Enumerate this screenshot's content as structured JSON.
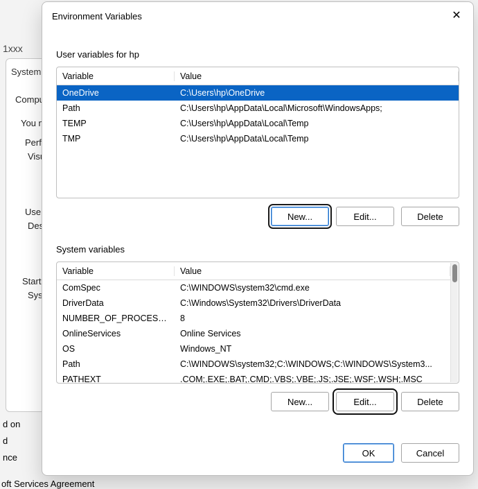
{
  "bg": {
    "top_label": "1xxx",
    "tab_text": "System P",
    "computer": "Compute",
    "you_m": "You m",
    "perfo": "Perfo",
    "visu": "Visu",
    "user": "User",
    "des": "Des",
    "startu": "Startu",
    "syst": "Syst",
    "frag_don": "d on",
    "frag_d": "d",
    "frag_nce": "nce",
    "link_frag": "oft Services Agreement"
  },
  "dialog": {
    "title": "Environment Variables",
    "close_glyph": "✕",
    "user_section_label": "User variables for hp",
    "system_section_label": "System variables",
    "col_variable": "Variable",
    "col_value": "Value",
    "btn_new": "New...",
    "btn_edit": "Edit...",
    "btn_delete": "Delete",
    "btn_ok": "OK",
    "btn_cancel": "Cancel"
  },
  "user_vars": [
    {
      "name": "OneDrive",
      "value": "C:\\Users\\hp\\OneDrive",
      "selected": true
    },
    {
      "name": "Path",
      "value": "C:\\Users\\hp\\AppData\\Local\\Microsoft\\WindowsApps;",
      "selected": false
    },
    {
      "name": "TEMP",
      "value": "C:\\Users\\hp\\AppData\\Local\\Temp",
      "selected": false
    },
    {
      "name": "TMP",
      "value": "C:\\Users\\hp\\AppData\\Local\\Temp",
      "selected": false
    }
  ],
  "system_vars": [
    {
      "name": "ComSpec",
      "value": "C:\\WINDOWS\\system32\\cmd.exe"
    },
    {
      "name": "DriverData",
      "value": "C:\\Windows\\System32\\Drivers\\DriverData"
    },
    {
      "name": "NUMBER_OF_PROCESSORS",
      "value": "8"
    },
    {
      "name": "OnlineServices",
      "value": "Online Services"
    },
    {
      "name": "OS",
      "value": "Windows_NT"
    },
    {
      "name": "Path",
      "value": "C:\\WINDOWS\\system32;C:\\WINDOWS;C:\\WINDOWS\\System3..."
    },
    {
      "name": "PATHEXT",
      "value": ".COM;.EXE;.BAT;.CMD;.VBS;.VBE;.JS;.JSE;.WSF;.WSH;.MSC"
    }
  ]
}
